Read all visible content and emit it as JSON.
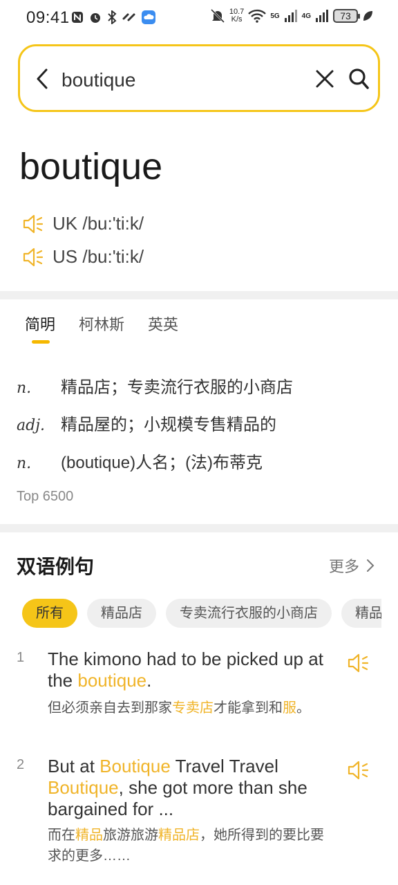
{
  "status_bar": {
    "time": "09:41",
    "speed_value": "10.7",
    "speed_unit": "K/s",
    "net1": "5G",
    "net2": "4G",
    "battery": "73"
  },
  "search": {
    "query": "boutique"
  },
  "entry": {
    "word": "boutique",
    "uk": "UK /bu:'ti:k/",
    "us": "US /bu:'ti:k/"
  },
  "tabs": [
    {
      "label": "简明"
    },
    {
      "label": "柯林斯"
    },
    {
      "label": "英英"
    }
  ],
  "definitions": [
    {
      "pos": "n.",
      "text": "精品店；专卖流行衣服的小商店"
    },
    {
      "pos": "adj.",
      "text": "精品屋的；小规模专售精品的"
    },
    {
      "pos": "n.",
      "text": "(boutique)人名；(法)布蒂克"
    }
  ],
  "rank": "Top 6500",
  "examples_section": {
    "title": "双语例句",
    "more": "更多"
  },
  "chips": [
    {
      "label": "所有"
    },
    {
      "label": "精品店"
    },
    {
      "label": "专卖流行衣服的小商店"
    },
    {
      "label": "精品"
    }
  ],
  "examples": [
    {
      "num": "1",
      "en": [
        {
          "t": "The kimono had to be picked up at the ",
          "hl": false
        },
        {
          "t": "boutique",
          "hl": true
        },
        {
          "t": ".",
          "hl": false
        }
      ],
      "zh": [
        {
          "t": "但必须亲自去到那家",
          "hl": false
        },
        {
          "t": "专卖店",
          "hl": true
        },
        {
          "t": "才能拿到和",
          "hl": false
        },
        {
          "t": "服",
          "hl": true
        },
        {
          "t": "。",
          "hl": false
        }
      ]
    },
    {
      "num": "2",
      "en": [
        {
          "t": "But at ",
          "hl": false
        },
        {
          "t": "Boutique",
          "hl": true
        },
        {
          "t": " Travel Travel ",
          "hl": false
        },
        {
          "t": "Boutique",
          "hl": true
        },
        {
          "t": ", she got more than she bargained for ...",
          "hl": false
        }
      ],
      "zh": [
        {
          "t": "而在",
          "hl": false
        },
        {
          "t": "精品",
          "hl": true
        },
        {
          "t": "旅游旅游",
          "hl": false
        },
        {
          "t": "精品店",
          "hl": true
        },
        {
          "t": "，她所得到的要比要求的更多……",
          "hl": false
        }
      ]
    }
  ],
  "colors": {
    "accent": "#F5C518",
    "highlight": "#F0B429"
  },
  "icons": {
    "back": "back-arrow-icon",
    "clear": "close-icon",
    "search": "search-icon",
    "speaker": "speaker-icon",
    "more": "chevron-right-icon"
  }
}
